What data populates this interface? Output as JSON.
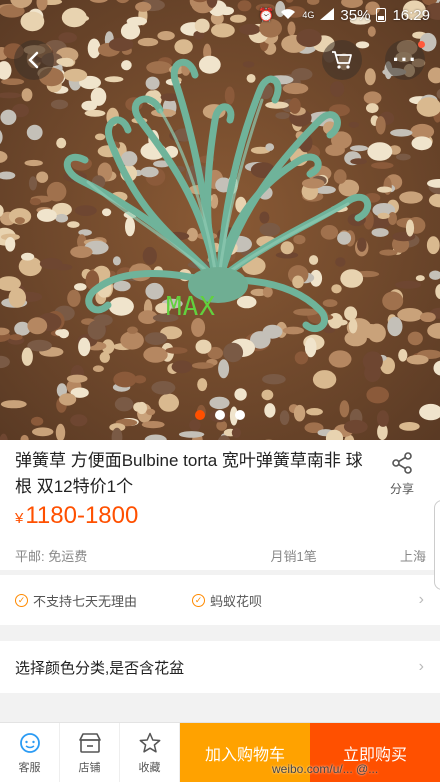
{
  "status_bar": {
    "battery": "35%",
    "time": "16:29",
    "network": "4G"
  },
  "hero": {
    "overlay_text": "MAX",
    "carousel": {
      "total": 3,
      "active": 1
    }
  },
  "product": {
    "title": "弹簧草 方便面Bulbine torta  宽叶弹簧草南非 球根 双12特价1个",
    "share_label": "分享",
    "price_symbol": "¥",
    "price": "1180-1800",
    "shipping": "平邮: 免运费",
    "monthly_sales": "月销1笔",
    "location": "上海"
  },
  "services": {
    "items": [
      "不支持七天无理由",
      "蚂蚁花呗"
    ]
  },
  "variant": {
    "label": "选择颜色分类,是否含花盆"
  },
  "bottom_bar": {
    "tabs": [
      {
        "label": "客服",
        "icon": "customer-service-icon"
      },
      {
        "label": "店铺",
        "icon": "store-icon"
      },
      {
        "label": "收藏",
        "icon": "star-icon"
      }
    ],
    "add_to_cart": "加入购物车",
    "buy_now": "立即购买"
  },
  "watermark": "weibo.com/u/...  @...",
  "colors": {
    "accent": "#ff5000",
    "add_cart_bg": "#ffa200",
    "buy_now_bg": "#ff5000"
  }
}
